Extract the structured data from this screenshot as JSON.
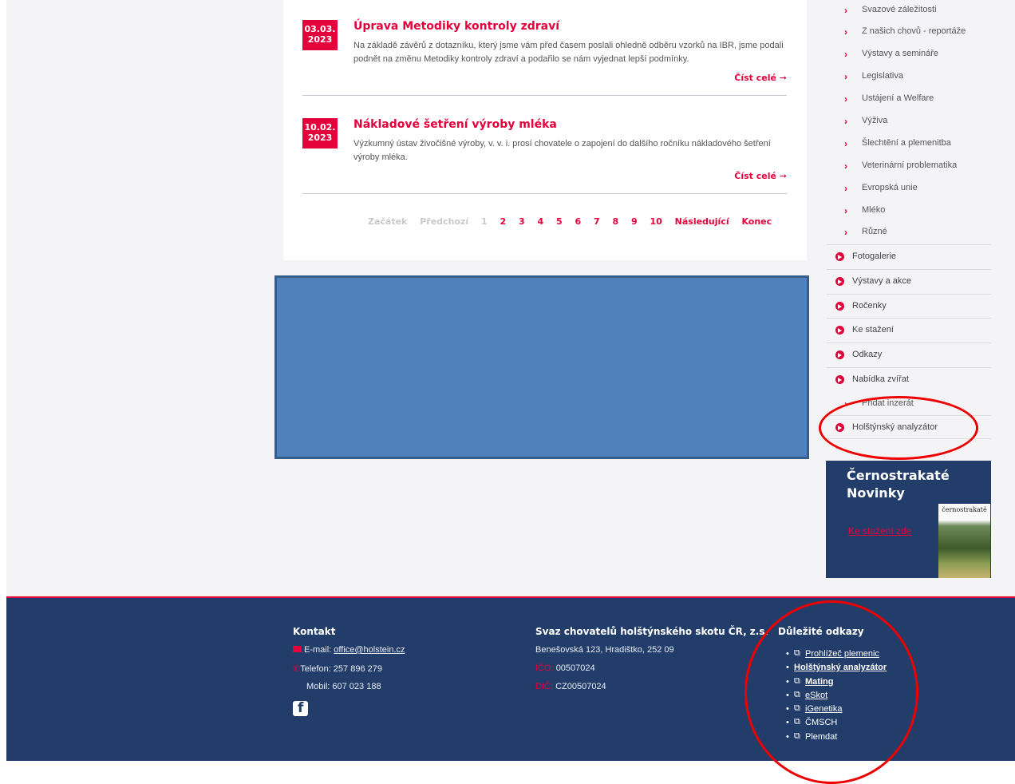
{
  "articles": [
    {
      "date_day": "03.03.",
      "date_year": "2023",
      "title": "Úprava Metodiky kontroly zdraví",
      "text": "Na základě závěrů z dotazníku, který jsme vám před časem poslali ohledně odběru vzorků na IBR, jsme podali podnět na změnu Metodiky kontroly zdraví a podařilo se nám vyjednat lepší podmínky.",
      "read_more": "Číst celé ➞"
    },
    {
      "date_day": "10.02.",
      "date_year": "2023",
      "title": "Nákladové šetření výroby mléka",
      "text": "Výzkumný ústav živočišné výroby, v. v. i. prosí chovatele o zapojení do dalšího ročníku nákladového šetření výroby mléka.",
      "read_more": "Číst celé ➞"
    }
  ],
  "pagination": {
    "first": "Začátek",
    "prev": "Předchozí",
    "current": "1",
    "pages": [
      "2",
      "3",
      "4",
      "5",
      "6",
      "7",
      "8",
      "9",
      "10"
    ],
    "next": "Následující",
    "last": "Konec"
  },
  "sidebar": {
    "sub_items": [
      "Svazové záležitosti",
      "Z našich chovů - reportáže",
      "Výstavy a semináře",
      "Legislativa",
      "Ustájení a Welfare",
      "Výživa",
      "Šlechtění a plemenitba",
      "Veterinární problematika",
      "Evropská unie",
      "Mléko",
      "Různé"
    ],
    "main_items": [
      "Fotogalerie",
      "Výstavy a akce",
      "Ročenky",
      "Ke stažení",
      "Odkazy",
      "Nabídka zvířat"
    ],
    "sub_add": "Přidat inzerát",
    "analyzer": "Holštýnský analyzátor"
  },
  "news_box": {
    "title": "Černostrakaté Novinky",
    "link": "Ke stažení zde",
    "cover_caption": "černostrakaté"
  },
  "footer": {
    "contact": {
      "heading": "Kontakt",
      "email_label": "E-mail:",
      "email": "office@holstein.cz",
      "phone_label": "Telefon: 257 896 279",
      "mobile_label": "Mobil: 607 023 188"
    },
    "org": {
      "heading": "Svaz chovatelů holštýnského skotu ČR, z.s.",
      "address": "Benešovská 123, Hradištko, 252 09",
      "ico_label": "IČO:",
      "ico": "00507024",
      "dic_label": "DIČ:",
      "dic": "CZ00507024"
    },
    "links": {
      "heading": "Důležité odkazy",
      "items": [
        "Prohlížeč plemenic",
        "Holštýnský analyzátor",
        "Mating",
        "eSkot",
        "iGenetika",
        "ČMSCH",
        "Plemdat"
      ]
    }
  },
  "colors": {
    "accent": "#e4003b",
    "navy": "#233d6b",
    "highlight_box": "#4f81bd",
    "annotation": "#e00000"
  }
}
